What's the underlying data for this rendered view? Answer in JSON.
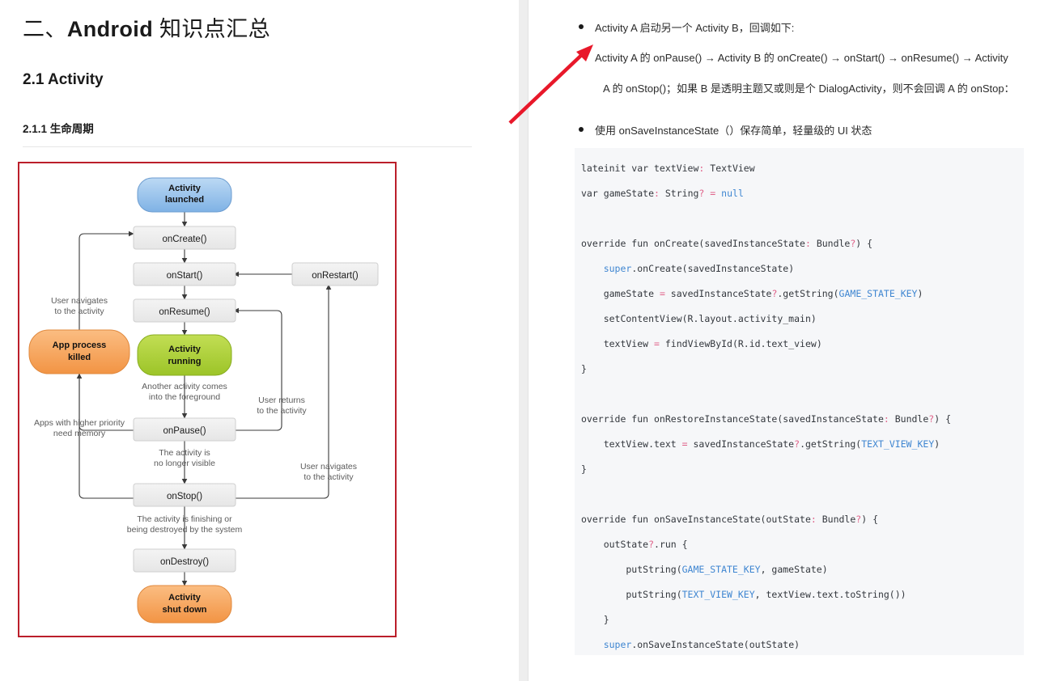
{
  "document": {
    "heading_1_prefix": "二、",
    "heading_1_bold": "Android",
    "heading_1_suffix": " 知识点汇总",
    "heading_2": "2.1 Activity",
    "heading_3": "2.1.1 生命周期"
  },
  "diagram": {
    "title": "Android Activity Lifecycle",
    "border_color": "#bb1f2a",
    "nodes": [
      {
        "id": "launched",
        "label_line1": "Activity",
        "label_line2": "launched",
        "shape": "pill",
        "fill": "#9dc8ef"
      },
      {
        "id": "oncreate",
        "label": "onCreate()",
        "shape": "rect",
        "fill": "#eeeeee"
      },
      {
        "id": "onstart",
        "label": "onStart()",
        "shape": "rect",
        "fill": "#eeeeee"
      },
      {
        "id": "onrestart",
        "label": "onRestart()",
        "shape": "rect",
        "fill": "#eeeeee"
      },
      {
        "id": "onresume",
        "label": "onResume()",
        "shape": "rect",
        "fill": "#eeeeee"
      },
      {
        "id": "running",
        "label_line1": "Activity",
        "label_line2": "running",
        "shape": "pill",
        "fill": "#a8cf3c"
      },
      {
        "id": "killed",
        "label_line1": "App process",
        "label_line2": "killed",
        "shape": "pill",
        "fill": "#f6a35c"
      },
      {
        "id": "onpause",
        "label": "onPause()",
        "shape": "rect",
        "fill": "#eeeeee"
      },
      {
        "id": "onstop",
        "label": "onStop()",
        "shape": "rect",
        "fill": "#eeeeee"
      },
      {
        "id": "ondestroy",
        "label": "onDestroy()",
        "shape": "rect",
        "fill": "#eeeeee"
      },
      {
        "id": "shutdown",
        "label_line1": "Activity",
        "label_line2": "shut down",
        "shape": "pill",
        "fill": "#f6a35c"
      }
    ],
    "edge_labels": [
      {
        "id": "user-nav-left",
        "line1": "User navigates",
        "line2": "to the activity"
      },
      {
        "id": "another-activity",
        "line1": "Another activity comes",
        "line2": "into the foreground"
      },
      {
        "id": "user-returns",
        "line1": "User returns",
        "line2": "to the activity"
      },
      {
        "id": "apps-higher",
        "line1": "Apps with higher priority",
        "line2": "need memory"
      },
      {
        "id": "no-longer",
        "line1": "The activity is",
        "line2": "no longer visible"
      },
      {
        "id": "user-nav-right",
        "line1": "User navigates",
        "line2": "to the activity"
      },
      {
        "id": "finishing",
        "line1": "The activity is finishing or",
        "line2": "being destroyed by the system"
      }
    ]
  },
  "notes": {
    "bullet_1": "Activity A 启动另一个 Activity B，回调如下:",
    "bullet_1_detail_line1": "Activity A 的 onPause() → Activity B 的 onCreate() → onStart() → onResume() → Activity",
    "bullet_1_detail_line2": "A 的 onStop()；如果 B 是透明主题又或则是个 DialogActivity，则不会回调 A 的 onStop：",
    "bullet_2": "使用 onSaveInstanceState（）保存简单，轻量级的 UI 状态"
  },
  "annotation": {
    "arrow_color": "#e8182a",
    "arrow_name": "red-pointer-arrow"
  },
  "code": {
    "language": "kotlin",
    "background": "#f6f7f9",
    "lines": [
      [
        {
          "t": "lateinit var textView",
          "c": "plain"
        },
        {
          "t": ":",
          "c": "typ"
        },
        {
          "t": " TextView",
          "c": "plain"
        }
      ],
      [
        {
          "t": "var gameState",
          "c": "plain"
        },
        {
          "t": ":",
          "c": "typ"
        },
        {
          "t": " String",
          "c": "plain"
        },
        {
          "t": "?",
          "c": "qm"
        },
        {
          "t": " ",
          "c": "plain"
        },
        {
          "t": "=",
          "c": "op"
        },
        {
          "t": " ",
          "c": "plain"
        },
        {
          "t": "null",
          "c": "kw"
        }
      ],
      [
        {
          "t": "",
          "c": "plain"
        }
      ],
      [
        {
          "t": "override fun onCreate(savedInstanceState",
          "c": "plain"
        },
        {
          "t": ":",
          "c": "typ"
        },
        {
          "t": " Bundle",
          "c": "plain"
        },
        {
          "t": "?",
          "c": "qm"
        },
        {
          "t": ") {",
          "c": "plain"
        }
      ],
      [
        {
          "t": "    ",
          "c": "plain"
        },
        {
          "t": "super",
          "c": "kw"
        },
        {
          "t": ".onCreate(savedInstanceState)",
          "c": "plain"
        }
      ],
      [
        {
          "t": "    gameState ",
          "c": "plain"
        },
        {
          "t": "=",
          "c": "op"
        },
        {
          "t": " savedInstanceState",
          "c": "plain"
        },
        {
          "t": "?",
          "c": "qm"
        },
        {
          "t": ".getString(",
          "c": "plain"
        },
        {
          "t": "GAME_STATE_KEY",
          "c": "const"
        },
        {
          "t": ")",
          "c": "plain"
        }
      ],
      [
        {
          "t": "    setContentView(R.layout.activity_main)",
          "c": "plain"
        }
      ],
      [
        {
          "t": "    textView ",
          "c": "plain"
        },
        {
          "t": "=",
          "c": "op"
        },
        {
          "t": " findViewById(R.id.text_view)",
          "c": "plain"
        }
      ],
      [
        {
          "t": "}",
          "c": "plain"
        }
      ],
      [
        {
          "t": "",
          "c": "plain"
        }
      ],
      [
        {
          "t": "override fun onRestoreInstanceState(savedInstanceState",
          "c": "plain"
        },
        {
          "t": ":",
          "c": "typ"
        },
        {
          "t": " Bundle",
          "c": "plain"
        },
        {
          "t": "?",
          "c": "qm"
        },
        {
          "t": ") {",
          "c": "plain"
        }
      ],
      [
        {
          "t": "    textView.text ",
          "c": "plain"
        },
        {
          "t": "=",
          "c": "op"
        },
        {
          "t": " savedInstanceState",
          "c": "plain"
        },
        {
          "t": "?",
          "c": "qm"
        },
        {
          "t": ".getString(",
          "c": "plain"
        },
        {
          "t": "TEXT_VIEW_KEY",
          "c": "const"
        },
        {
          "t": ")",
          "c": "plain"
        }
      ],
      [
        {
          "t": "}",
          "c": "plain"
        }
      ],
      [
        {
          "t": "",
          "c": "plain"
        }
      ],
      [
        {
          "t": "override fun onSaveInstanceState(outState",
          "c": "plain"
        },
        {
          "t": ":",
          "c": "typ"
        },
        {
          "t": " Bundle",
          "c": "plain"
        },
        {
          "t": "?",
          "c": "qm"
        },
        {
          "t": ") {",
          "c": "plain"
        }
      ],
      [
        {
          "t": "    outState",
          "c": "plain"
        },
        {
          "t": "?",
          "c": "qm"
        },
        {
          "t": ".run {",
          "c": "plain"
        }
      ],
      [
        {
          "t": "        putString(",
          "c": "plain"
        },
        {
          "t": "GAME_STATE_KEY",
          "c": "const"
        },
        {
          "t": ", gameState)",
          "c": "plain"
        }
      ],
      [
        {
          "t": "        putString(",
          "c": "plain"
        },
        {
          "t": "TEXT_VIEW_KEY",
          "c": "const"
        },
        {
          "t": ", textView.text.toString())",
          "c": "plain"
        }
      ],
      [
        {
          "t": "    }",
          "c": "plain"
        }
      ],
      [
        {
          "t": "    ",
          "c": "plain"
        },
        {
          "t": "super",
          "c": "kw"
        },
        {
          "t": ".onSaveInstanceState(outState)",
          "c": "plain"
        }
      ]
    ]
  }
}
